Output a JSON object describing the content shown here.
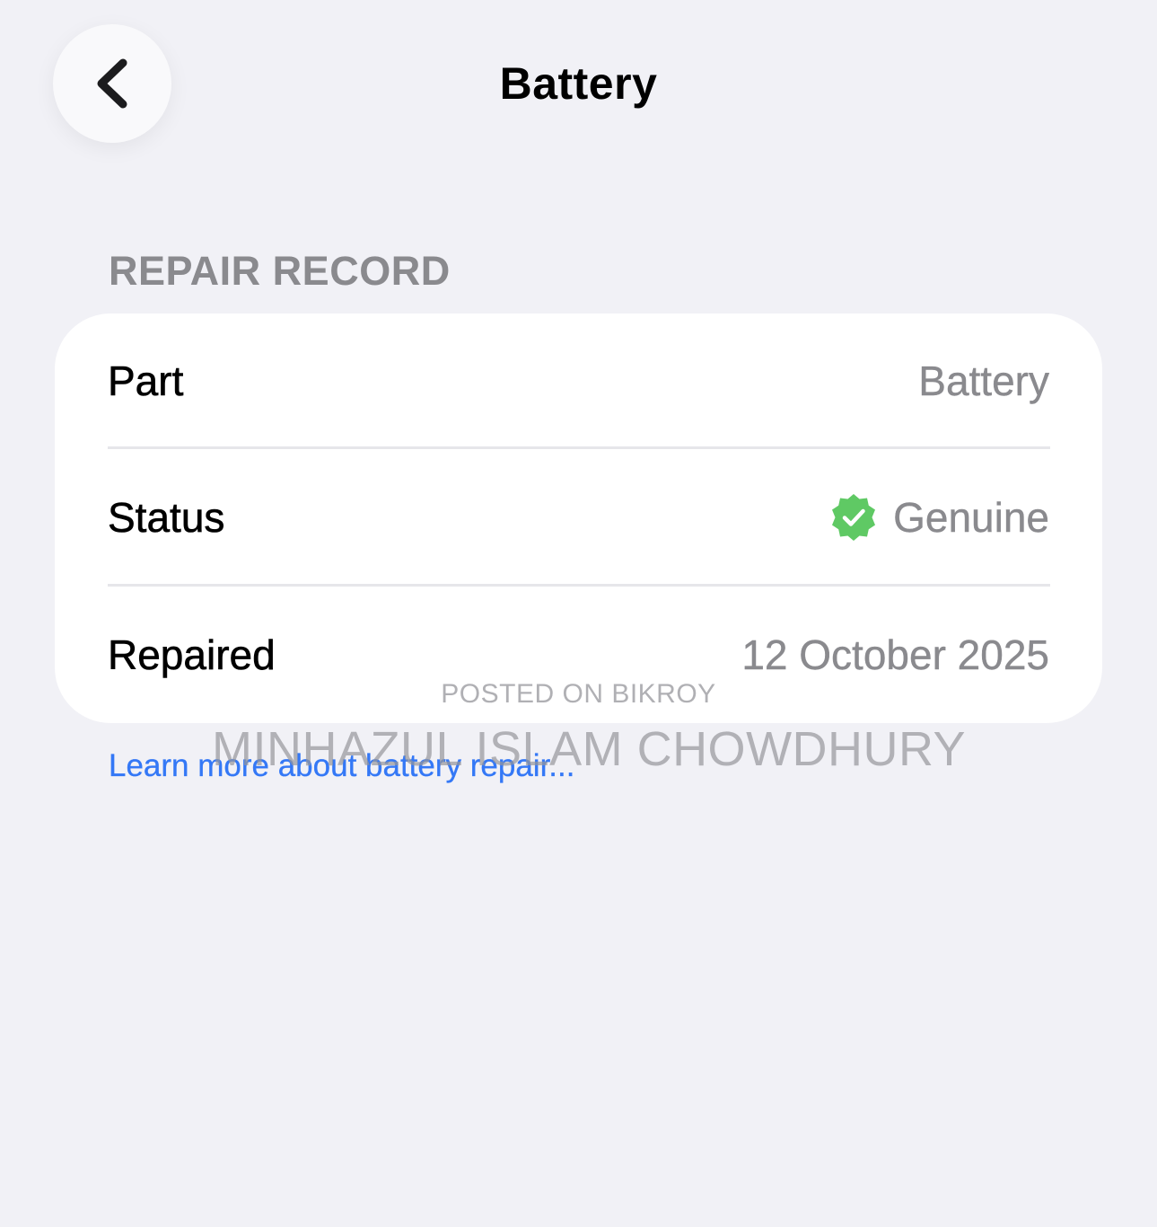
{
  "nav": {
    "title": "Battery",
    "back_icon": "chevron-left-icon"
  },
  "section": {
    "header": "REPAIR RECORD"
  },
  "rows": [
    {
      "label": "Part",
      "value": "Battery"
    },
    {
      "label": "Status",
      "value": "Genuine",
      "icon": "verified-check-icon",
      "icon_color": "#5fc964"
    },
    {
      "label": "Repaired",
      "value": "12 October 2025"
    }
  ],
  "link": {
    "text": "Learn more about battery repair..."
  },
  "watermark": {
    "line1": "POSTED ON BIKROY",
    "line2": "MINHAZUL ISLAM CHOWDHURY"
  },
  "colors": {
    "background": "#f1f1f6",
    "card": "#ffffff",
    "secondary_text": "#8a8a8e",
    "link": "#3478f6",
    "badge_green": "#5fc964"
  }
}
